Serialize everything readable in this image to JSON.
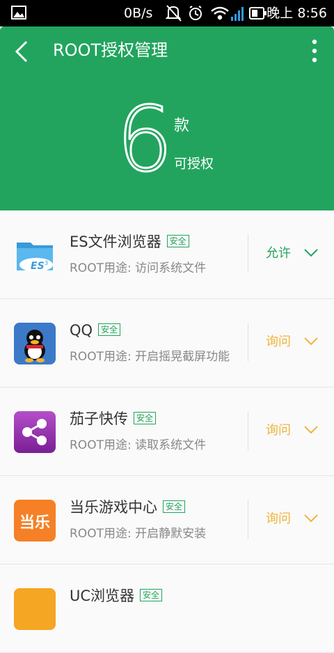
{
  "status_bar": {
    "speed": "0B/s",
    "time": "晚上 8:56"
  },
  "header": {
    "title": "ROOT授权管理",
    "count": "6",
    "unit": "款",
    "subtitle": "可授权"
  },
  "apps": [
    {
      "name": "ES文件浏览器",
      "badge": "安全",
      "desc": "ROOT用途: 访问系统文件",
      "action": "允许",
      "action_color": "#22a45e"
    },
    {
      "name": "QQ",
      "badge": "安全",
      "desc": "ROOT用途: 开启摇晃截屏功能",
      "action": "询问",
      "action_color": "#f0b43c"
    },
    {
      "name": "茄子快传",
      "badge": "安全",
      "desc": "ROOT用途: 读取系统文件",
      "action": "询问",
      "action_color": "#f0b43c"
    },
    {
      "name": "当乐游戏中心",
      "badge": "安全",
      "desc": "ROOT用途: 开启静默安装",
      "action": "询问",
      "action_color": "#f0b43c",
      "icon_text": "当乐"
    },
    {
      "name": "UC浏览器",
      "badge": "安全"
    }
  ]
}
